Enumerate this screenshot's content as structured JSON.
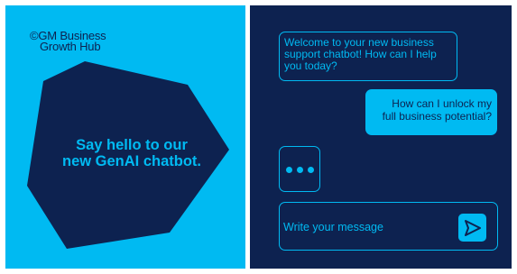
{
  "colors": {
    "accent": "#00baf2",
    "dark": "#0d2250",
    "background": "#ffffff"
  },
  "promo": {
    "brand_lines": [
      "©GM Business",
      "Growth Hub"
    ],
    "headline_lines": [
      "Say hello to our",
      "new GenAI chatbot."
    ]
  },
  "chat": {
    "bot_message": "Welcome to your new business support chatbot! How can I help you today?",
    "user_message_lines": [
      "How can I unlock my",
      "full business potential?"
    ],
    "typing_indicator": "typing-dots-icon",
    "input_placeholder": "Write your message",
    "send_icon": "send-arrow-icon"
  }
}
